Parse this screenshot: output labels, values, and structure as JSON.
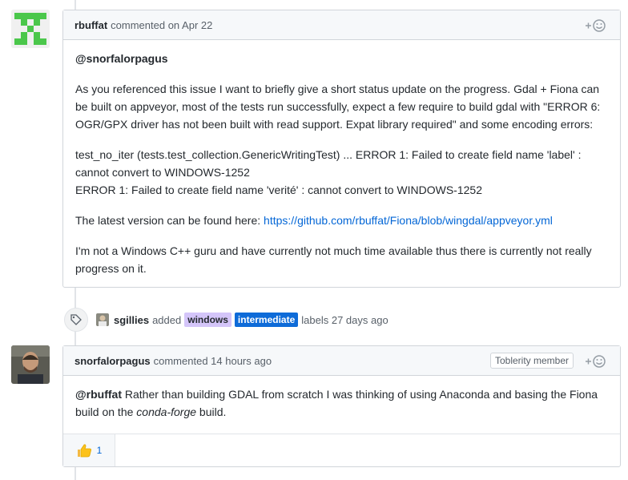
{
  "comment1": {
    "author": "rbuffat",
    "meta": "commented on Apr 22",
    "mention": "@snorfalorpagus",
    "para1": "As you referenced this issue I want to briefly give a short status update on the progress. Gdal + Fiona can be built on appveyor, most of the tests run successfully, expect a few require to build gdal with \"ERROR 6: OGR/GPX driver has not been built with read support. Expat library required\" and some encoding errors:",
    "error_line1": "test_no_iter (tests.test_collection.GenericWritingTest) ... ERROR 1: Failed to create field name 'label' : cannot convert to WINDOWS-1252",
    "error_line2": "ERROR 1: Failed to create field name 'verité' : cannot convert to WINDOWS-1252",
    "latest_prefix": "The latest version can be found here: ",
    "latest_link": "https://github.com/rbuffat/Fiona/blob/wingdal/appveyor.yml",
    "para4": "I'm not a Windows C++ guru and have currently not much time available thus there is currently not really progress on it."
  },
  "event": {
    "actor": "sgillies",
    "action": "added",
    "labels": [
      {
        "name": "windows",
        "bg": "#d4c5f9",
        "fg": "#24292e"
      },
      {
        "name": "intermediate",
        "bg": "#0e6bd8",
        "fg": "#ffffff"
      }
    ],
    "suffix": "labels 27 days ago"
  },
  "comment2": {
    "author": "snorfalorpagus",
    "meta": "commented 14 hours ago",
    "badge": "Toblerity member",
    "mention": "@rbuffat",
    "text_a": " Rather than building GDAL from scratch I was thinking of using Anaconda and basing the Fiona build on the ",
    "emph": "conda-forge",
    "text_b": " build.",
    "reaction_count": "1"
  },
  "icons": {
    "reaction": "smiley-plus-icon",
    "tag": "tag-icon",
    "thumbs": "thumbs-up-icon"
  },
  "colors": {
    "link": "#0366d6",
    "header_bg": "#f6f8fa",
    "border": "#d1d5da"
  }
}
